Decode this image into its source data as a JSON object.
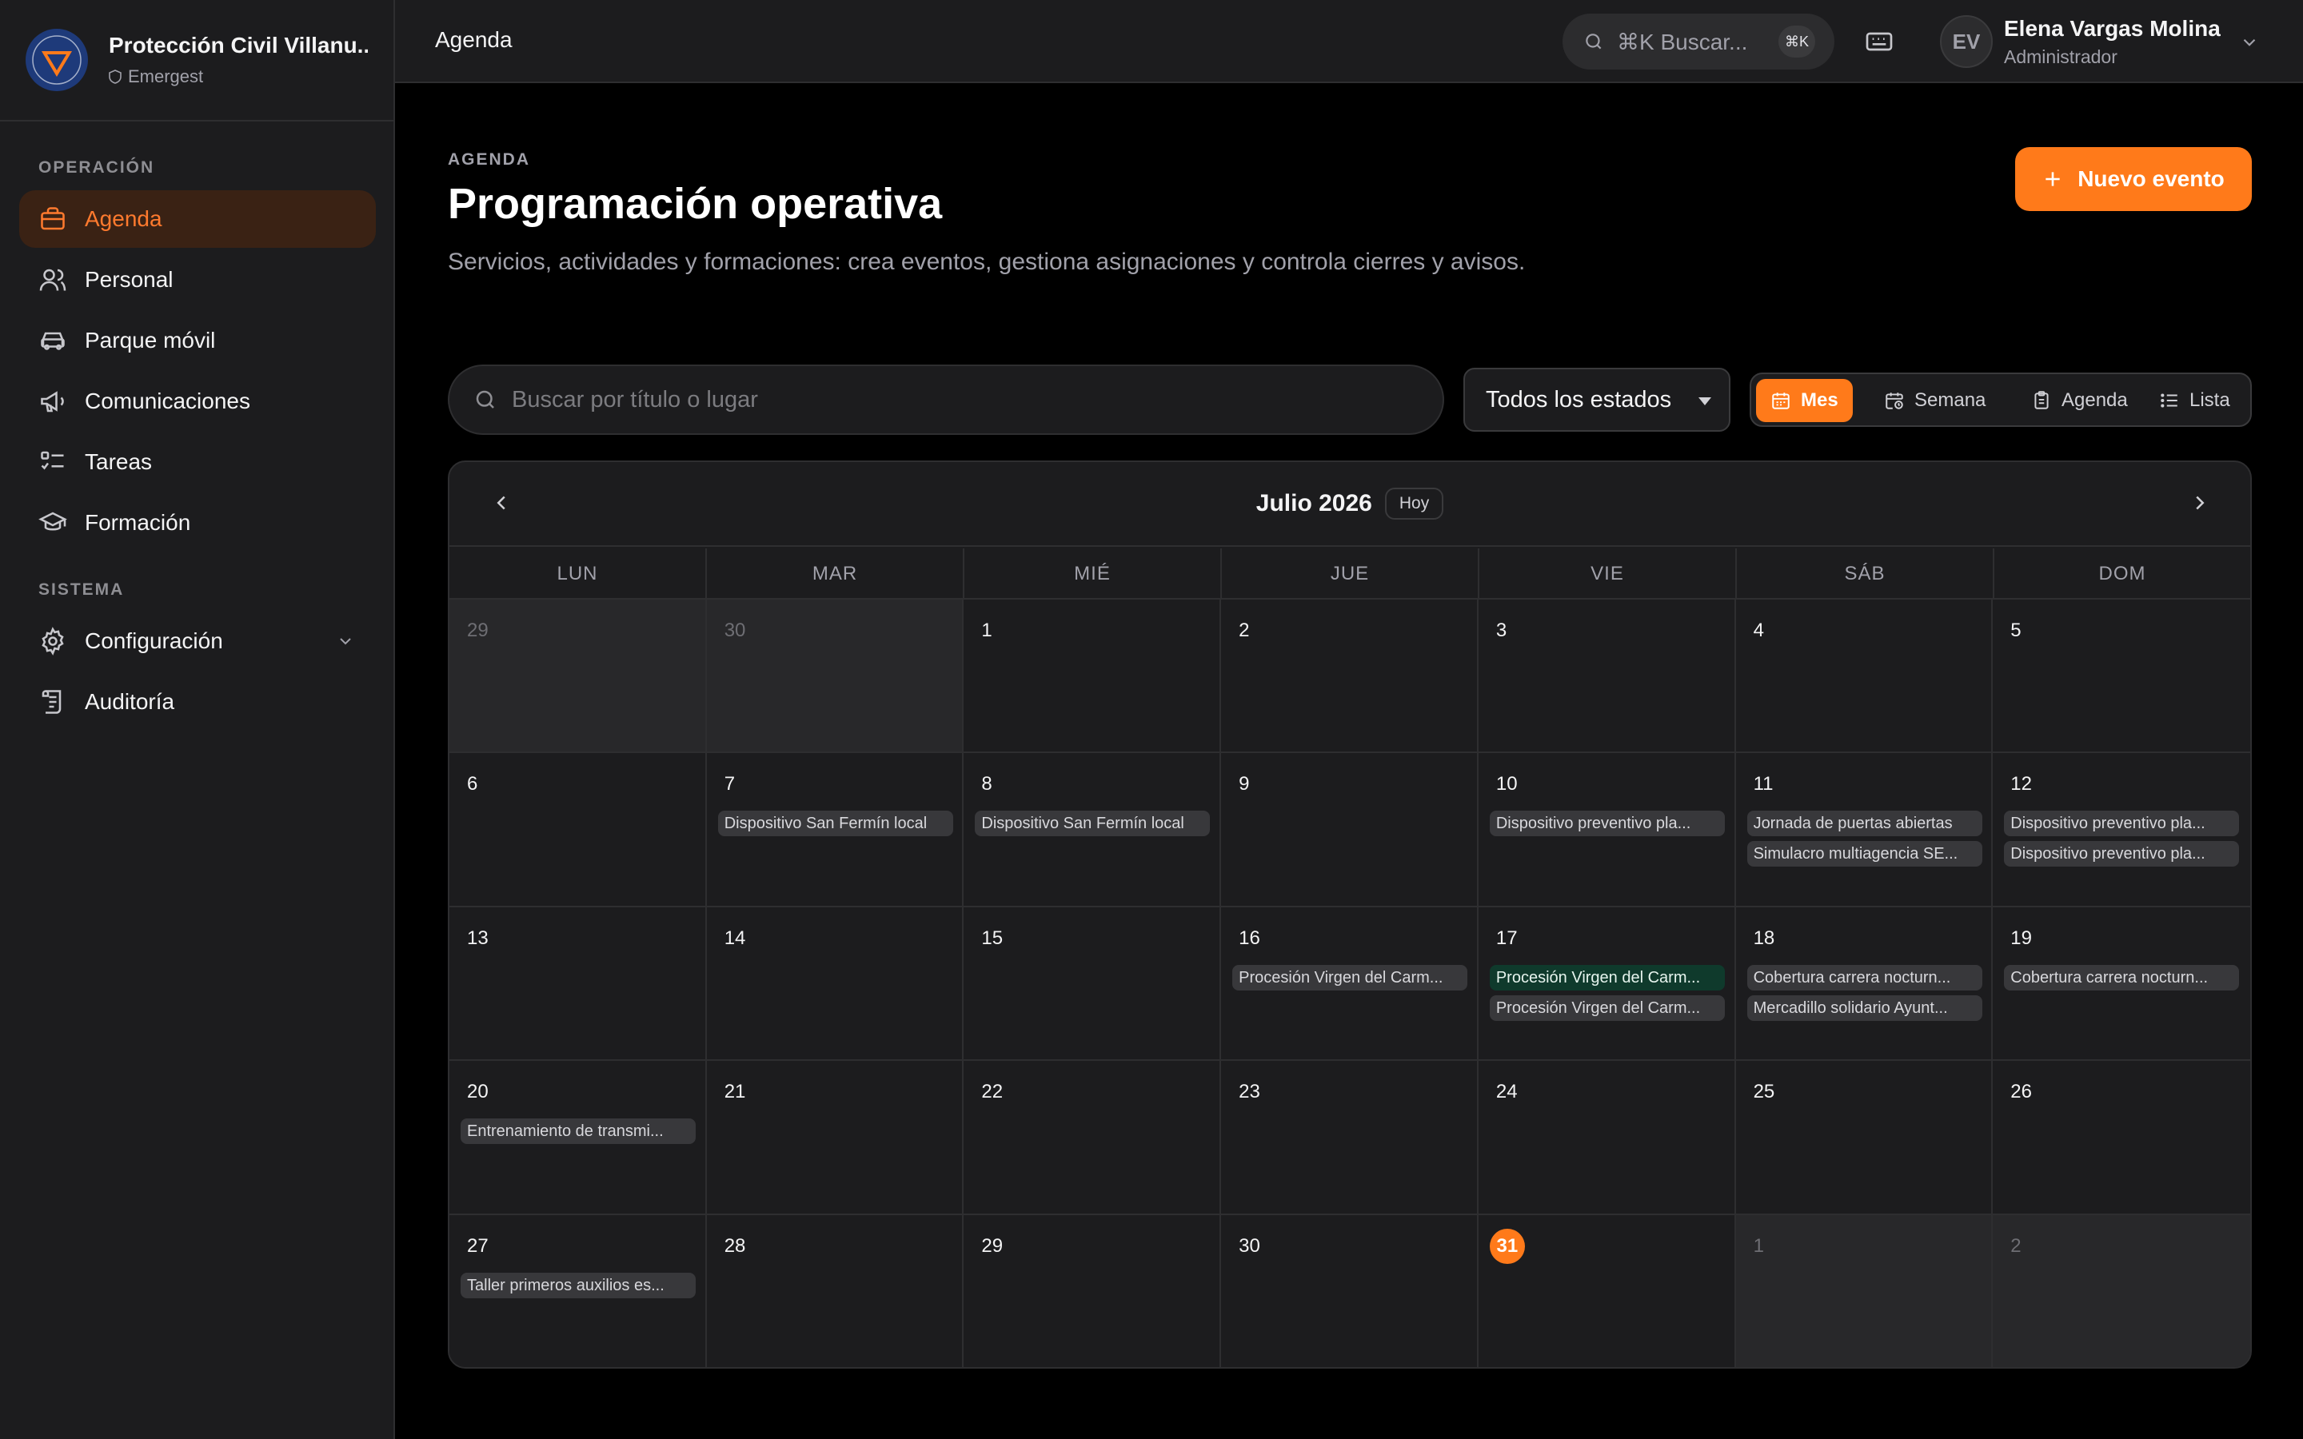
{
  "brand": {
    "name": "Protección Civil Villanu...",
    "subtitle": "Emergest",
    "logo_text": "PROTECCIÓN CIVIL",
    "colors": {
      "orange": "#ff7a1a",
      "navy": "#1e3a7a"
    }
  },
  "sidebar": {
    "sections": [
      {
        "label": "OPERACIÓN",
        "items": [
          {
            "label": "Agenda",
            "icon": "briefcase-icon",
            "active": true
          },
          {
            "label": "Personal",
            "icon": "users-icon"
          },
          {
            "label": "Parque móvil",
            "icon": "car-icon"
          },
          {
            "label": "Comunicaciones",
            "icon": "megaphone-icon"
          },
          {
            "label": "Tareas",
            "icon": "checklist-icon"
          },
          {
            "label": "Formación",
            "icon": "graduation-cap-icon"
          }
        ]
      },
      {
        "label": "SISTEMA",
        "items": [
          {
            "label": "Configuración",
            "icon": "gear-icon",
            "expandable": true
          },
          {
            "label": "Auditoría",
            "icon": "scroll-icon"
          }
        ]
      }
    ]
  },
  "topbar": {
    "title": "Agenda",
    "search_placeholder": "⌘K Buscar...",
    "search_shortcut": "⌘K",
    "user": {
      "initials": "EV",
      "name": "Elena Vargas Molina",
      "role": "Administrador"
    }
  },
  "main": {
    "eyebrow": "AGENDA",
    "title": "Programación operativa",
    "description": "Servicios, actividades y formaciones: crea eventos, gestiona asignaciones y controla cierres y avisos.",
    "new_event_label": "Nuevo evento",
    "search_placeholder": "Buscar por título o lugar",
    "status_filter": "Todos los estados",
    "views": [
      {
        "label": "Mes",
        "icon": "calendar-icon",
        "active": true
      },
      {
        "label": "Semana",
        "icon": "calendar-clock-icon"
      },
      {
        "label": "Agenda",
        "icon": "clipboard-icon"
      },
      {
        "label": "Lista",
        "icon": "list-icon"
      }
    ]
  },
  "calendar": {
    "month_label": "Julio 2026",
    "today_label": "Hoy",
    "weekdays": [
      "LUN",
      "MAR",
      "MIÉ",
      "JUE",
      "VIE",
      "SÁB",
      "DOM"
    ],
    "weeks": [
      [
        {
          "day": "29",
          "muted": true,
          "events": []
        },
        {
          "day": "30",
          "muted": true,
          "events": []
        },
        {
          "day": "1",
          "events": []
        },
        {
          "day": "2",
          "events": []
        },
        {
          "day": "3",
          "events": []
        },
        {
          "day": "4",
          "events": []
        },
        {
          "day": "5",
          "events": []
        }
      ],
      [
        {
          "day": "6",
          "events": []
        },
        {
          "day": "7",
          "events": [
            {
              "title": "Dispositivo San Fermín local"
            }
          ]
        },
        {
          "day": "8",
          "events": [
            {
              "title": "Dispositivo San Fermín local"
            }
          ]
        },
        {
          "day": "9",
          "events": []
        },
        {
          "day": "10",
          "events": [
            {
              "title": "Dispositivo preventivo pla..."
            }
          ]
        },
        {
          "day": "11",
          "events": [
            {
              "title": "Jornada de puertas abiertas"
            },
            {
              "title": "Simulacro multiagencia SE..."
            }
          ]
        },
        {
          "day": "12",
          "events": [
            {
              "title": "Dispositivo preventivo pla..."
            },
            {
              "title": "Dispositivo preventivo pla..."
            }
          ]
        }
      ],
      [
        {
          "day": "13",
          "events": []
        },
        {
          "day": "14",
          "events": []
        },
        {
          "day": "15",
          "events": []
        },
        {
          "day": "16",
          "events": [
            {
              "title": "Procesión Virgen del Carm..."
            }
          ]
        },
        {
          "day": "17",
          "events": [
            {
              "title": "Procesión Virgen del Carm...",
              "highlight": "green"
            },
            {
              "title": "Procesión Virgen del Carm..."
            }
          ]
        },
        {
          "day": "18",
          "events": [
            {
              "title": "Cobertura carrera nocturn..."
            },
            {
              "title": "Mercadillo solidario Ayunt..."
            }
          ]
        },
        {
          "day": "19",
          "events": [
            {
              "title": "Cobertura carrera nocturn..."
            }
          ]
        }
      ],
      [
        {
          "day": "20",
          "events": [
            {
              "title": "Entrenamiento de transmi..."
            }
          ]
        },
        {
          "day": "21",
          "events": []
        },
        {
          "day": "22",
          "events": []
        },
        {
          "day": "23",
          "events": []
        },
        {
          "day": "24",
          "events": []
        },
        {
          "day": "25",
          "events": []
        },
        {
          "day": "26",
          "events": []
        }
      ],
      [
        {
          "day": "27",
          "events": [
            {
              "title": "Taller primeros auxilios es..."
            }
          ]
        },
        {
          "day": "28",
          "events": []
        },
        {
          "day": "29",
          "events": []
        },
        {
          "day": "30",
          "events": []
        },
        {
          "day": "31",
          "today": true,
          "events": []
        },
        {
          "day": "1",
          "muted": true,
          "events": []
        },
        {
          "day": "2",
          "muted": true,
          "events": []
        }
      ]
    ]
  }
}
